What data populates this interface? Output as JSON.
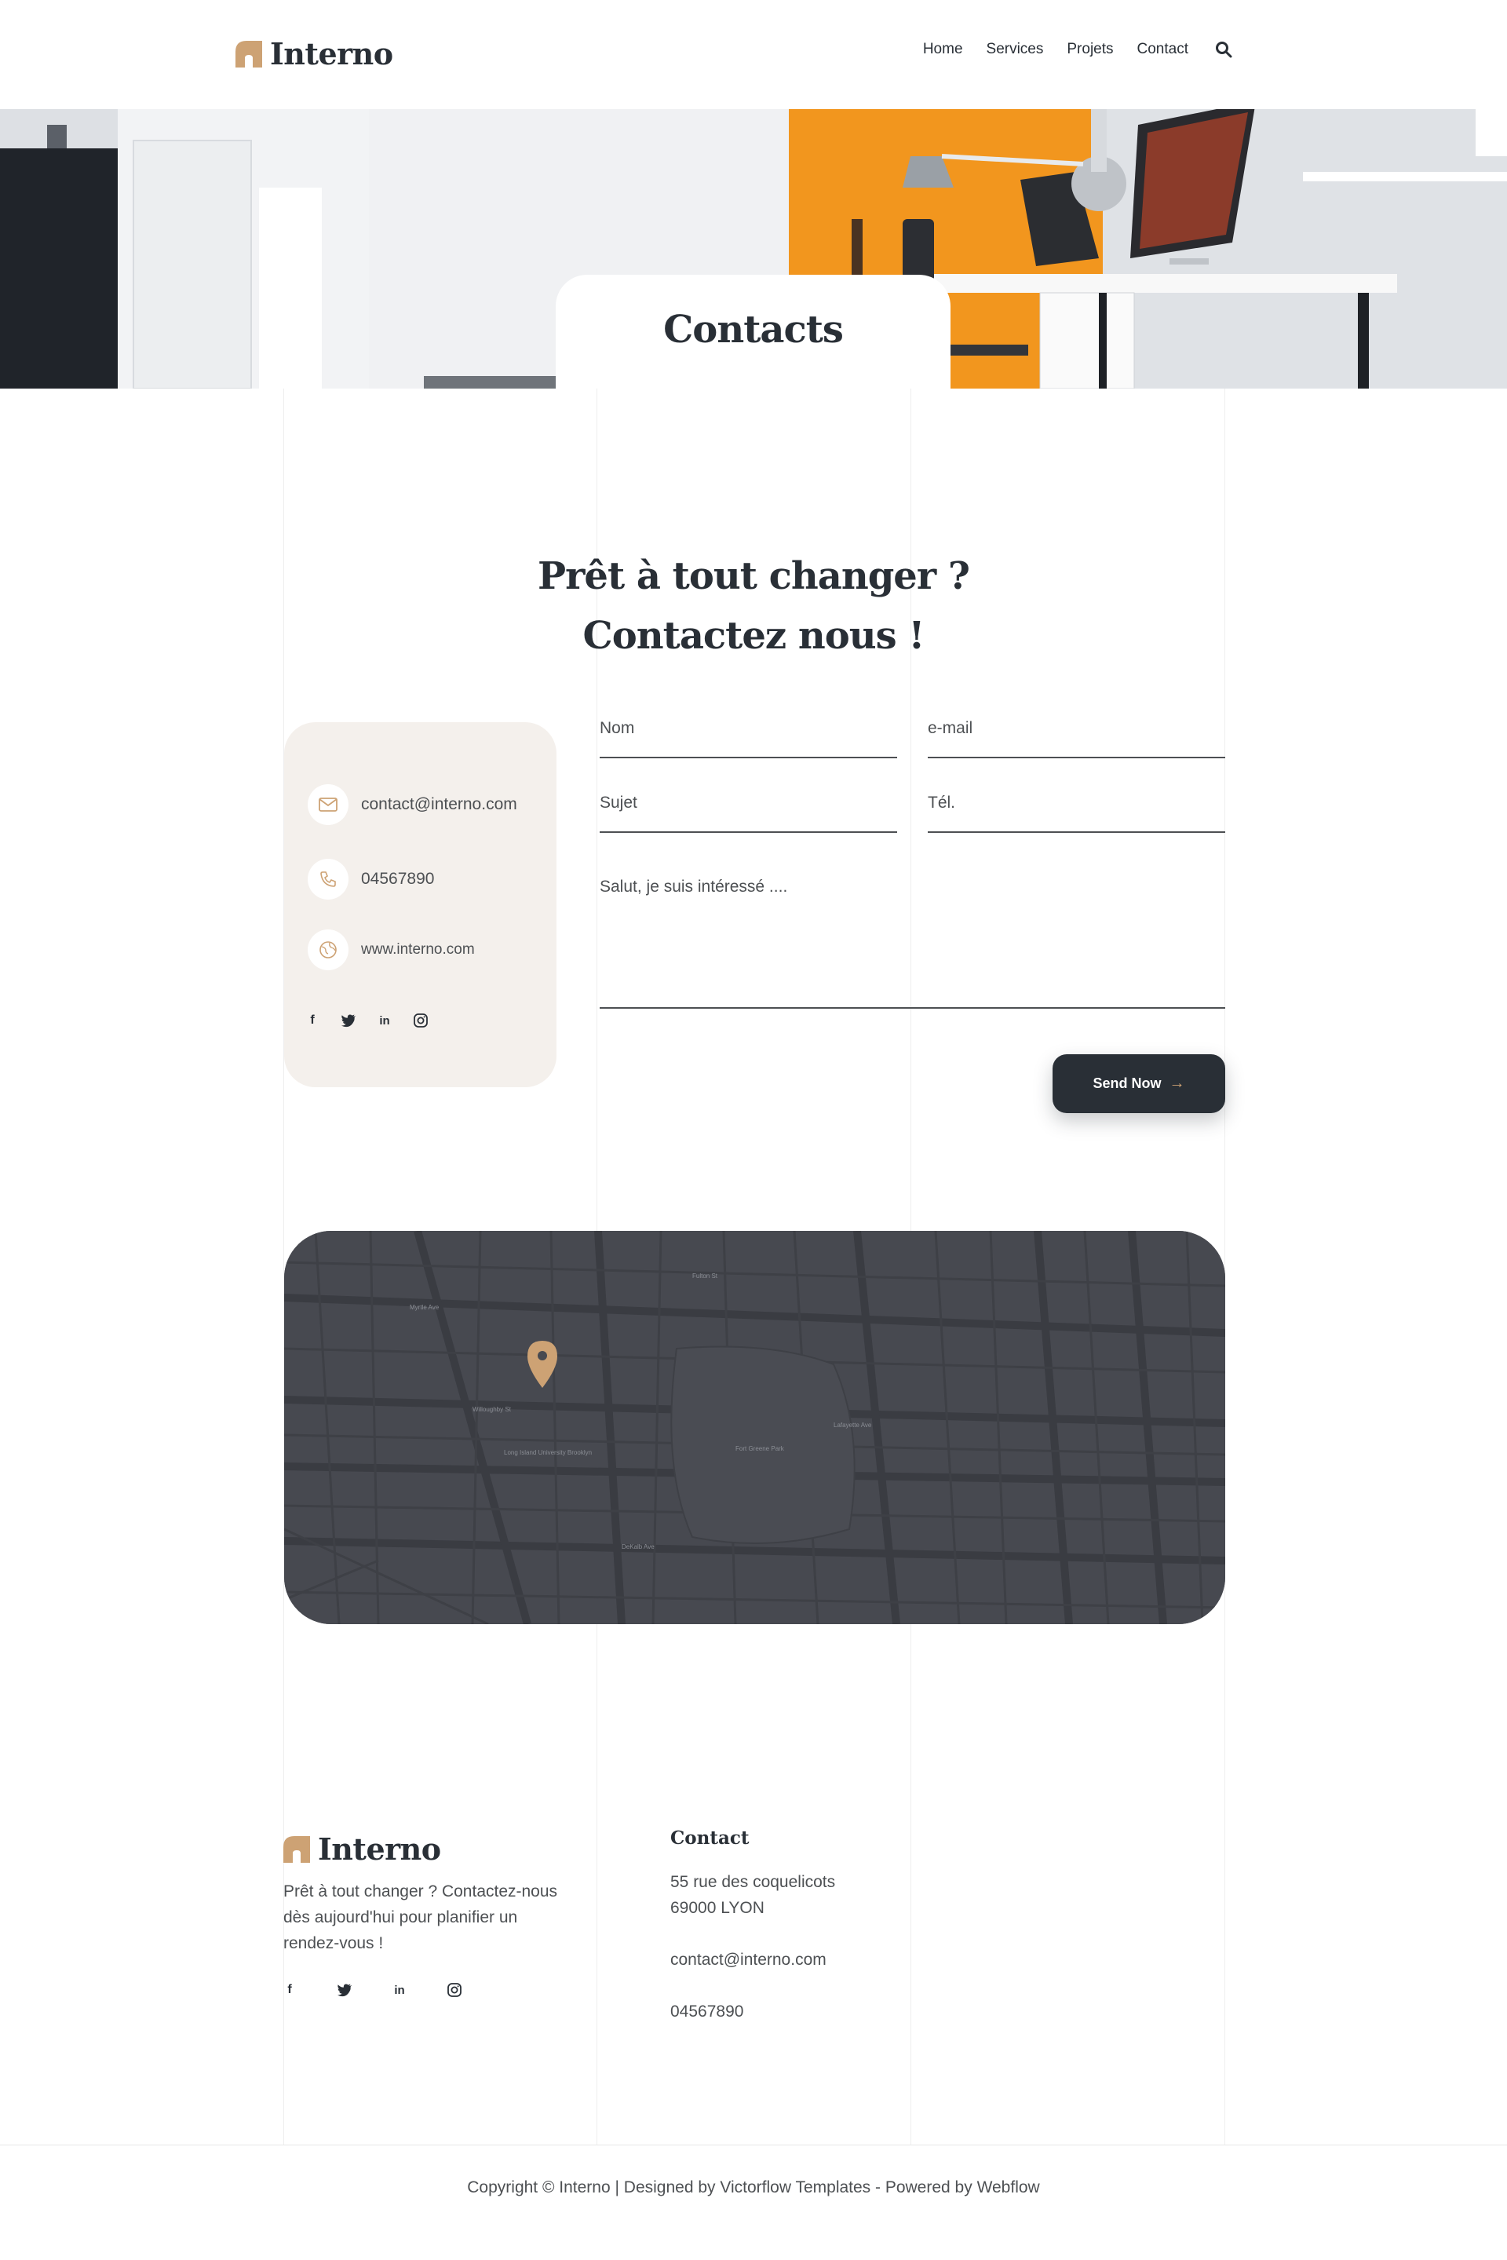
{
  "brand": {
    "name": "Interno",
    "accent": "#cda274",
    "dark": "#292f36",
    "cream": "#f4f0ec"
  },
  "nav": {
    "items": [
      "Home",
      "Services",
      "Projets",
      "Contact"
    ],
    "search_icon": "search-icon"
  },
  "hero": {
    "title": "Contacts"
  },
  "cta": {
    "line1": "Prêt à tout changer ?",
    "line2": "Contactez nous !"
  },
  "info": {
    "email": "contact@interno.com",
    "phone": "04567890",
    "website": "www.interno.com",
    "socials": [
      "facebook-icon",
      "twitter-icon",
      "linkedin-icon",
      "instagram-icon"
    ]
  },
  "form": {
    "name_placeholder": "Nom",
    "email_placeholder": "e-mail",
    "subject_placeholder": "Sujet",
    "phone_placeholder": "Tél.",
    "message_placeholder": "Salut, je suis intéressé ....",
    "send_label": "Send Now"
  },
  "map": {
    "labels": [
      "Myrtle Ave",
      "Willoughby St",
      "DeKalb Ave",
      "Long Island University Brooklyn",
      "Fort Greene Park",
      "Lafayette Ave",
      "Fulton St"
    ]
  },
  "footer": {
    "brand": "Interno",
    "description": "Prêt à tout changer ? Contactez-nous dès aujourd'hui pour planifier un rendez-vous !",
    "contact_title": "Contact",
    "address_line1": "55 rue des coquelicots",
    "address_line2": "69000 LYON",
    "email": "contact@interno.com",
    "phone": "04567890",
    "copyright": "Copyright © Interno | Designed by Victorflow Templates - Powered by Webflow"
  }
}
